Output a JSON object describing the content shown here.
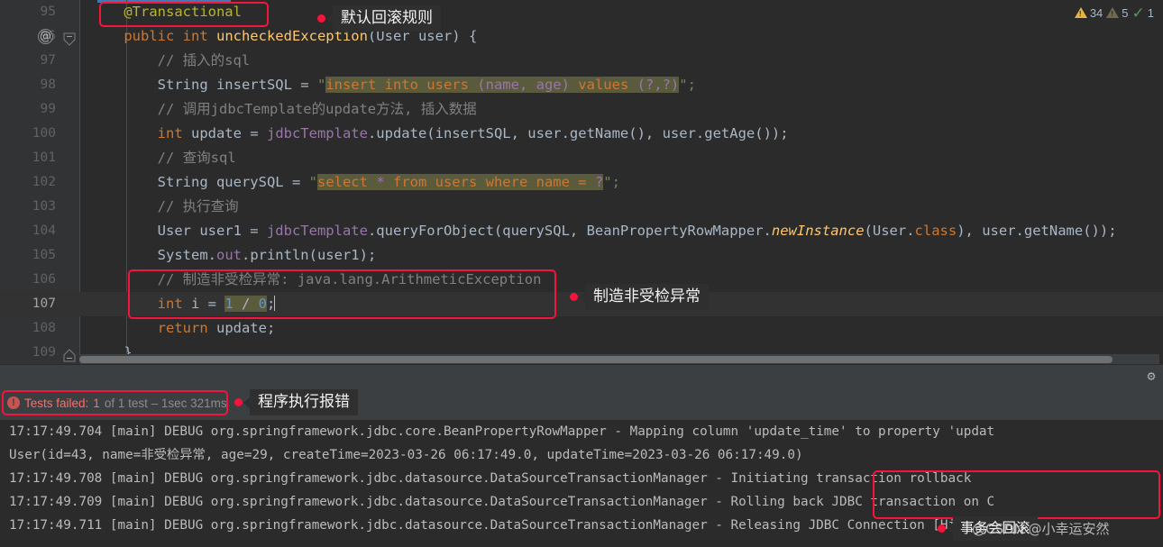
{
  "editor": {
    "lines": [
      {
        "num": "95",
        "current": false,
        "gutter_at": false,
        "fold": null,
        "tokens": [
          {
            "t": "    ",
            "c": "plain"
          },
          {
            "t": "@Transactional",
            "c": "anno"
          }
        ]
      },
      {
        "num": "96",
        "current": false,
        "gutter_at": true,
        "fold": "minus",
        "tokens": [
          {
            "t": "    ",
            "c": "plain"
          },
          {
            "t": "public ",
            "c": "kw"
          },
          {
            "t": "int ",
            "c": "kw"
          },
          {
            "t": "uncheckedException",
            "c": "mth"
          },
          {
            "t": "(User user) {",
            "c": "plain"
          }
        ]
      },
      {
        "num": "97",
        "current": false,
        "gutter_at": false,
        "fold": null,
        "tokens": [
          {
            "t": "        ",
            "c": "plain"
          },
          {
            "t": "// 插入的sql",
            "c": "cmt"
          }
        ]
      },
      {
        "num": "98",
        "current": false,
        "gutter_at": false,
        "fold": null,
        "tokens": [
          {
            "t": "        String insertSQL = ",
            "c": "plain"
          },
          {
            "t": "\"",
            "c": "str"
          },
          {
            "t": "insert into users ",
            "c": "sql"
          },
          {
            "t": "(name, age)",
            "c": "sqlp"
          },
          {
            "t": " values ",
            "c": "sql"
          },
          {
            "t": "(?,?)",
            "c": "sqlp"
          },
          {
            "t": "\";",
            "c": "str"
          }
        ]
      },
      {
        "num": "99",
        "current": false,
        "gutter_at": false,
        "fold": null,
        "tokens": [
          {
            "t": "        ",
            "c": "plain"
          },
          {
            "t": "// 调用jdbcTemplate的update方法, 插入数据",
            "c": "cmt"
          }
        ]
      },
      {
        "num": "100",
        "current": false,
        "gutter_at": false,
        "fold": null,
        "tokens": [
          {
            "t": "        ",
            "c": "plain"
          },
          {
            "t": "int ",
            "c": "kw"
          },
          {
            "t": "update = ",
            "c": "plain"
          },
          {
            "t": "jdbcTemplate",
            "c": "fld"
          },
          {
            "t": ".update(insertSQL, user.getName(), user.getAge());",
            "c": "plain"
          }
        ]
      },
      {
        "num": "101",
        "current": false,
        "gutter_at": false,
        "fold": null,
        "tokens": [
          {
            "t": "        ",
            "c": "plain"
          },
          {
            "t": "// 查询sql",
            "c": "cmt"
          }
        ]
      },
      {
        "num": "102",
        "current": false,
        "gutter_at": false,
        "fold": null,
        "tokens": [
          {
            "t": "        String querySQL = ",
            "c": "plain"
          },
          {
            "t": "\"",
            "c": "str"
          },
          {
            "t": "select ",
            "c": "sql"
          },
          {
            "t": "*",
            "c": "sqlp"
          },
          {
            "t": " from users where name = ",
            "c": "sql"
          },
          {
            "t": "?",
            "c": "sqlp"
          },
          {
            "t": "\";",
            "c": "str"
          }
        ]
      },
      {
        "num": "103",
        "current": false,
        "gutter_at": false,
        "fold": null,
        "tokens": [
          {
            "t": "        ",
            "c": "plain"
          },
          {
            "t": "// 执行查询",
            "c": "cmt"
          }
        ]
      },
      {
        "num": "104",
        "current": false,
        "gutter_at": false,
        "fold": null,
        "tokens": [
          {
            "t": "        User user1 = ",
            "c": "plain"
          },
          {
            "t": "jdbcTemplate",
            "c": "fld"
          },
          {
            "t": ".queryForObject(querySQL, BeanPropertyRowMapper.",
            "c": "plain"
          },
          {
            "t": "newInstance",
            "c": "ital"
          },
          {
            "t": "(User.",
            "c": "plain"
          },
          {
            "t": "class",
            "c": "kw"
          },
          {
            "t": "), user.getName());",
            "c": "plain"
          }
        ]
      },
      {
        "num": "105",
        "current": false,
        "gutter_at": false,
        "fold": null,
        "tokens": [
          {
            "t": "        System.",
            "c": "plain"
          },
          {
            "t": "out",
            "c": "fld"
          },
          {
            "t": ".println(user1);",
            "c": "plain"
          }
        ]
      },
      {
        "num": "106",
        "current": false,
        "gutter_at": false,
        "fold": null,
        "tokens": [
          {
            "t": "        ",
            "c": "plain"
          },
          {
            "t": "// 制造非受检异常: java.lang.ArithmeticException",
            "c": "cmt"
          }
        ]
      },
      {
        "num": "107",
        "current": true,
        "gutter_at": false,
        "fold": null,
        "tokens": [
          {
            "t": "        ",
            "c": "plain"
          },
          {
            "t": "int ",
            "c": "kw"
          },
          {
            "t": "i = ",
            "c": "plain"
          },
          {
            "t": "1",
            "c": "num hl"
          },
          {
            "t": " / ",
            "c": "plain hl"
          },
          {
            "t": "0",
            "c": "num hl"
          },
          {
            "t": ";",
            "c": "plain"
          }
        ],
        "caret": true
      },
      {
        "num": "108",
        "current": false,
        "gutter_at": false,
        "fold": null,
        "tokens": [
          {
            "t": "        ",
            "c": "plain"
          },
          {
            "t": "return ",
            "c": "kw"
          },
          {
            "t": "update;",
            "c": "plain"
          }
        ]
      },
      {
        "num": "109",
        "current": false,
        "gutter_at": false,
        "fold": "minus2",
        "tokens": [
          {
            "t": "    }",
            "c": "plain"
          }
        ]
      }
    ]
  },
  "inspections": {
    "warning_count": "34",
    "weak_warning_count": "5",
    "typo_count": "1"
  },
  "test_bar": {
    "icon": "error-circle-icon",
    "label": "Tests failed:",
    "count": "1",
    "of_text": " of 1 test – 1sec 321ms"
  },
  "console": {
    "lines": [
      "17:17:49.704 [main] DEBUG org.springframework.jdbc.core.BeanPropertyRowMapper - Mapping column 'update_time' to property 'updat",
      "User(id=43, name=非受检异常, age=29, createTime=2023-03-26 06:17:49.0, updateTime=2023-03-26 06:17:49.0)",
      "17:17:49.708 [main] DEBUG org.springframework.jdbc.datasource.DataSourceTransactionManager - Initiating transaction rollback",
      "17:17:49.709 [main] DEBUG org.springframework.jdbc.datasource.DataSourceTransactionManager - Rolling back JDBC transaction on C",
      "17:17:49.711 [main] DEBUG org.springframework.jdbc.datasource.DataSourceTransactionManager - Releasing JDBC Connection [HikariPs"
    ]
  },
  "annotations": [
    {
      "name": "default-rollback-rule",
      "text": "默认回滚规则"
    },
    {
      "name": "create-unchecked-exception",
      "text": "制造非受检异常"
    },
    {
      "name": "program-execution-error",
      "text": "程序执行报错"
    },
    {
      "name": "transaction-will-rollback",
      "text": "事务会回滚"
    }
  ],
  "watermark": "@CSDN @小幸运安然",
  "colors": {
    "highlight_box": "#f4143c",
    "editor_bg": "#2b2b2b",
    "panel_bg": "#3c3f41",
    "annotation_color": "#bbb529",
    "keyword_color": "#cc7832",
    "string_color": "#6a8759",
    "error_color": "#ff6b68"
  },
  "gear_icon": "gear-icon"
}
